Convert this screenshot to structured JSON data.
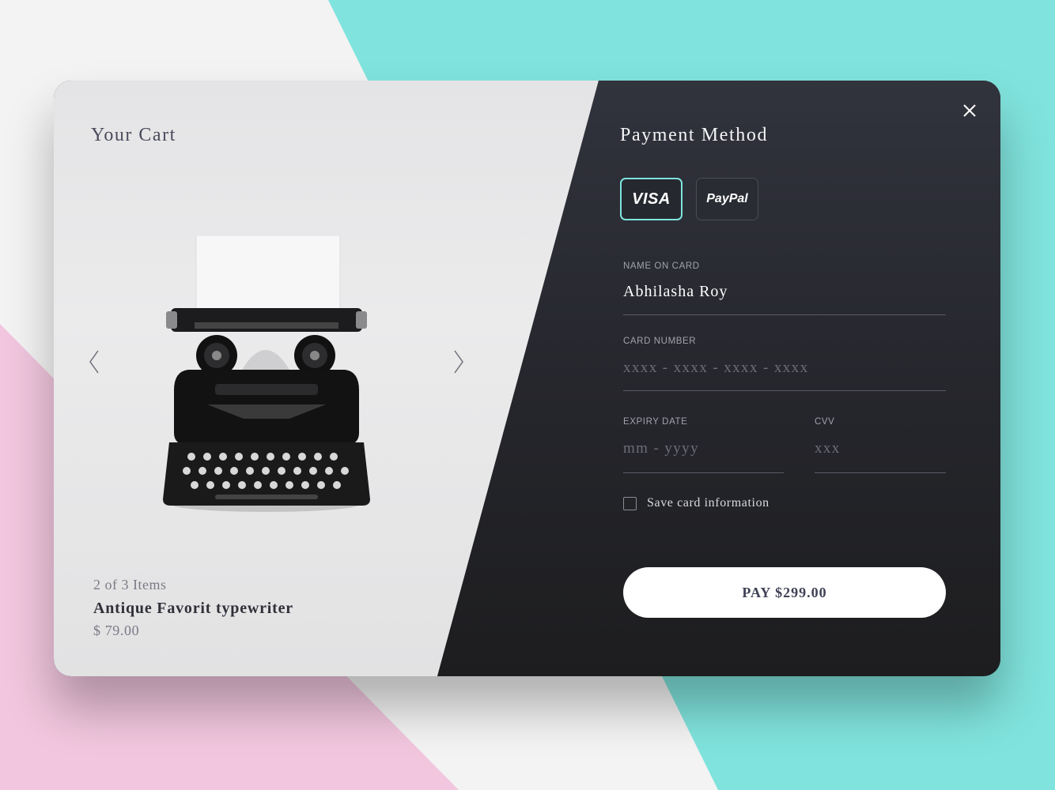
{
  "cart": {
    "title": "Your Cart",
    "item_count": "2 of 3 Items",
    "item_name": "Antique Favorit typewriter",
    "item_price": "$ 79.00",
    "product_image": "typewriter"
  },
  "payment": {
    "title": "Payment Method",
    "methods": [
      {
        "label": "VISA",
        "selected": true
      },
      {
        "label": "PayPal",
        "selected": false
      }
    ],
    "fields": {
      "name_label": "NAME ON CARD",
      "name_value": "Abhilasha Roy",
      "card_label": "CARD NUMBER",
      "card_placeholder": "xxxx - xxxx - xxxx - xxxx",
      "expiry_label": "EXPIRY DATE",
      "expiry_placeholder": "mm - yyyy",
      "cvv_label": "CVV",
      "cvv_placeholder": "xxx"
    },
    "save_card_label": "Save card information",
    "save_card_checked": false,
    "pay_button": "PAY $299.00"
  },
  "icons": {
    "close": "close-icon",
    "prev": "chevron-left-icon",
    "next": "chevron-right-icon"
  },
  "colors": {
    "accent": "#7fe3dd",
    "panel_dark": "#2a2c34",
    "pink": "#f1c6de",
    "teal": "#80e3dd"
  }
}
